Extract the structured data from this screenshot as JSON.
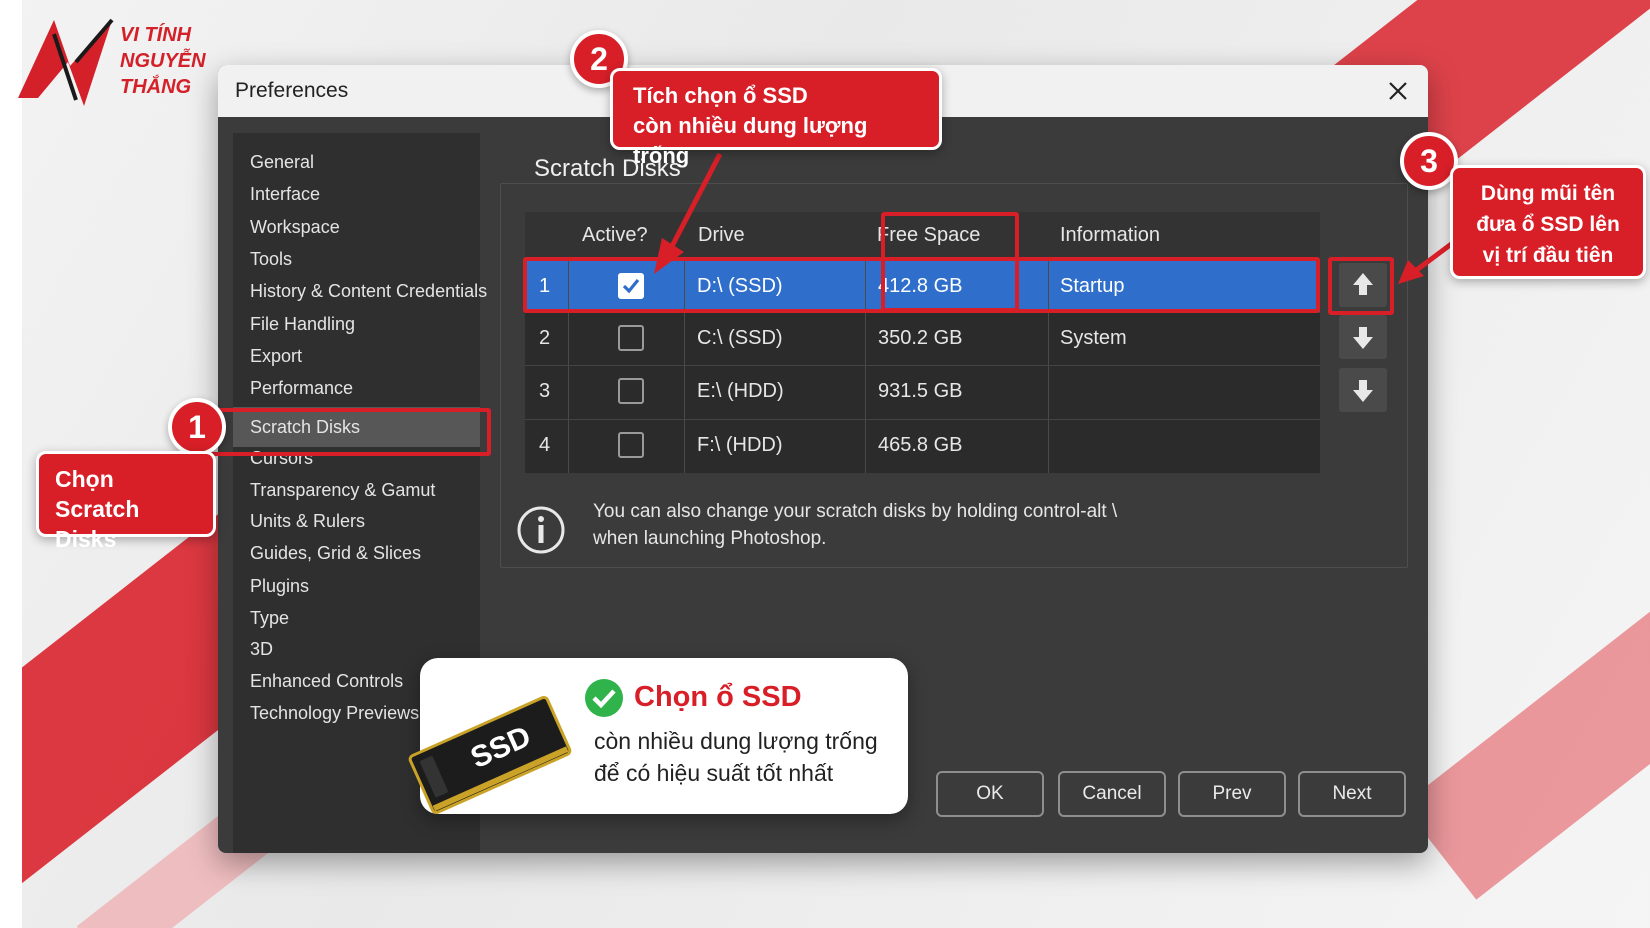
{
  "logo": {
    "line1": "VI TÍNH",
    "line2": "NGUYỄN",
    "line3": "THẮNG"
  },
  "dialog": {
    "title": "Preferences"
  },
  "sidebar": {
    "items": [
      {
        "label": "General"
      },
      {
        "label": "Interface"
      },
      {
        "label": "Workspace"
      },
      {
        "label": "Tools"
      },
      {
        "label": "History & Content Credentials"
      },
      {
        "label": "File Handling"
      },
      {
        "label": "Export"
      },
      {
        "label": "Performance"
      },
      {
        "label": "Scratch Disks",
        "selected": true
      },
      {
        "label": "Cursors"
      },
      {
        "label": "Transparency & Gamut"
      },
      {
        "label": "Units & Rulers"
      },
      {
        "label": "Guides, Grid & Slices"
      },
      {
        "label": "Plugins"
      },
      {
        "label": "Type"
      },
      {
        "label": "3D"
      },
      {
        "label": "Enhanced Controls"
      },
      {
        "label": "Technology Previews"
      }
    ]
  },
  "content": {
    "heading": "Scratch Disks"
  },
  "table": {
    "headers": {
      "active": "Active?",
      "drive": "Drive",
      "free_space": "Free Space",
      "information": "Information"
    },
    "rows": [
      {
        "num": "1",
        "active": true,
        "drive": "D:\\ (SSD)",
        "free": "412.8 GB",
        "info": "Startup"
      },
      {
        "num": "2",
        "active": false,
        "drive": "C:\\ (SSD)",
        "free": "350.2 GB",
        "info": "System"
      },
      {
        "num": "3",
        "active": false,
        "drive": "E:\\ (HDD)",
        "free": "931.5 GB",
        "info": ""
      },
      {
        "num": "4",
        "active": false,
        "drive": "F:\\ (HDD)",
        "free": "465.8 GB",
        "info": ""
      }
    ]
  },
  "info_note": {
    "line1": "You can also change your scratch disks by holding control-alt \\",
    "line2": "when launching Photoshop."
  },
  "buttons": {
    "ok": "OK",
    "cancel": "Cancel",
    "prev": "Prev",
    "next": "Next"
  },
  "annotations": {
    "badge1": "1",
    "badge2": "2",
    "badge3": "3",
    "callout1": {
      "line1": "Chọn",
      "line2": "Scratch Disks"
    },
    "callout2": {
      "line1": "Tích chọn ổ SSD",
      "line2": "còn nhiều dung lượng trống"
    },
    "callout3": {
      "line1": "Dùng mũi tên",
      "line2": "đưa ổ SSD lên",
      "line3": "vị trí đầu tiên"
    }
  },
  "promo": {
    "title": "Chọn ổ SSD",
    "line1": "còn nhiều dung lượng trống",
    "line2": "để có hiệu suất tốt nhất",
    "chip_label": "SSD"
  },
  "colors": {
    "accent_red": "#d81f28",
    "selection_blue": "#2f6fcb",
    "dialog_bg": "#3b3b3b"
  }
}
